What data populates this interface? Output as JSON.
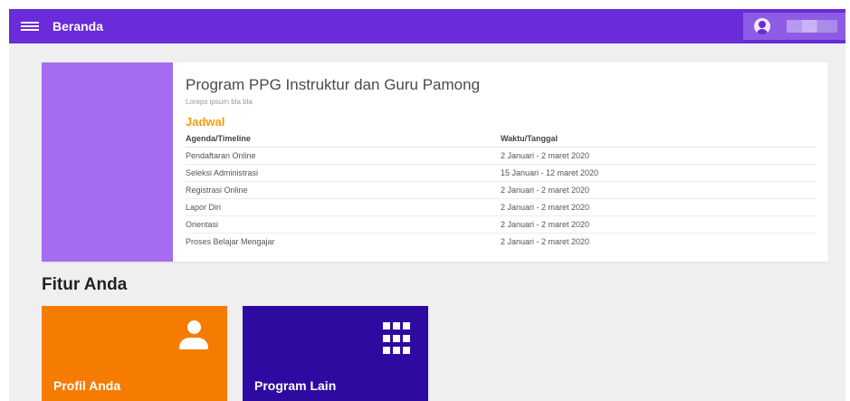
{
  "header": {
    "menu_icon": "hamburger-menu-icon",
    "title": "Beranda",
    "user": {
      "avatar_icon": "account-circle-icon"
    }
  },
  "program": {
    "title": "Program PPG Instruktur dan Guru Pamong",
    "subtitle": "Loreps ipsum bla bla",
    "section_label": "Jadwal",
    "columns": [
      "Agenda/Timeline",
      "Waktu/Tanggal"
    ],
    "rows": [
      [
        "Pendaftaran Online",
        "2 Januari - 2 maret 2020"
      ],
      [
        "Seleksi Administrasi",
        "15 Januari - 12 maret 2020"
      ],
      [
        "Registrasi Online",
        "2 Januari - 2 maret 2020"
      ],
      [
        "Lapor Diri",
        "2 Januari - 2 maret 2020"
      ],
      [
        "Orientasi",
        "2 Januari - 2 maret 2020"
      ],
      [
        "Proses Belajar Mengajar",
        "2 Januari - 2 maret 2020"
      ]
    ]
  },
  "features": {
    "title": "Fitur Anda",
    "tiles": [
      {
        "label": "Profil Anda",
        "icon": "person-icon",
        "color": "#f57c00"
      },
      {
        "label": "Program Lain",
        "icon": "apps-grid-icon",
        "color": "#2e0aa0"
      }
    ]
  },
  "colors": {
    "primary": "#6a2bd8",
    "card_image": "#a56cf2",
    "accent": "#f39c12"
  }
}
